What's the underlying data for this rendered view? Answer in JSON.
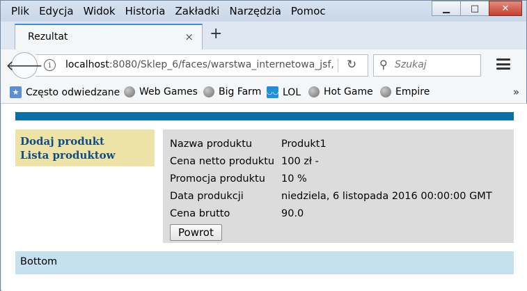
{
  "window": {
    "menu": [
      "Plik",
      "Edycja",
      "Widok",
      "Historia",
      "Zakładki",
      "Narzędzia",
      "Pomoc"
    ],
    "controls": {
      "minimize": "▭",
      "maximize": "□",
      "close": "✕"
    }
  },
  "tab": {
    "title": "Rezultat",
    "close_glyph": "×",
    "new_tab_glyph": "+"
  },
  "nav": {
    "url_host": "localhost",
    "url_rest": ":8080/Sklep_6/faces/warstwa_internetowa_jsf,",
    "search_placeholder": "Szukaj"
  },
  "bookmarks": [
    {
      "label": "Często odwiedzane",
      "icon": "bookmark-star-icon"
    },
    {
      "label": "Web Games",
      "icon": "globe-icon"
    },
    {
      "label": "Big Farm",
      "icon": "globe-icon"
    },
    {
      "label": "LOL",
      "icon": "lol-icon"
    },
    {
      "label": "Hot Game",
      "icon": "globe-icon"
    },
    {
      "label": "Empire",
      "icon": "globe-icon"
    }
  ],
  "bookmarks_more": "»",
  "sidebar": {
    "items": [
      "Dodaj produkt",
      "Lista produktow"
    ]
  },
  "product": {
    "rows": [
      {
        "label": "Nazwa produktu",
        "value": "Produkt1"
      },
      {
        "label": "Cena netto produktu",
        "value": "100 zł -"
      },
      {
        "label": "Promocja produktu",
        "value": "10 %"
      },
      {
        "label": "Data produkcji",
        "value": "niedziela, 6 listopada 2016 00:00:00 GMT"
      },
      {
        "label": "Cena brutto",
        "value": "90.0"
      }
    ],
    "back_label": "Powrot"
  },
  "footer": {
    "text": "Bottom"
  },
  "colors": {
    "top_band": "#0b6ea8",
    "sidebar_bg": "#ede3a7",
    "sidebar_link": "#134d80",
    "panel_bg": "#dcdcdc",
    "footer_bg": "#c5e1ef"
  }
}
